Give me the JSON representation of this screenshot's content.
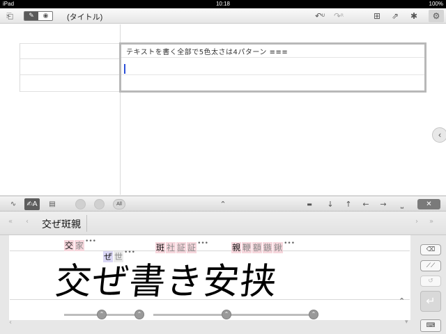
{
  "status_bar": {
    "device": "iPad",
    "time": "10:18",
    "battery": "100%"
  },
  "toolbar": {
    "title": "(タイトル)",
    "undo_label": "U",
    "redo_label": "R"
  },
  "document": {
    "textbox_handwriting": "テキストを書く全部で5色太さは4パターン ≡≡≡"
  },
  "input_panel": {
    "all_label": "All",
    "converted_text": "交ぜ斑親",
    "candidate_groups": [
      {
        "chars": [
          "交",
          "家"
        ]
      },
      {
        "chars": [
          "ぜ",
          "世"
        ]
      },
      {
        "chars": [
          "斑",
          "社",
          "証",
          "証"
        ]
      },
      {
        "chars": [
          "親",
          "鞭",
          "額",
          "鏃",
          "鍬"
        ]
      }
    ],
    "handwriting": "交ぜ書き安挟"
  },
  "colors": {
    "cursor": "#2a4ed8",
    "candidate_pink": "#f6d6dc",
    "candidate_blue": "#d9d6f4"
  }
}
